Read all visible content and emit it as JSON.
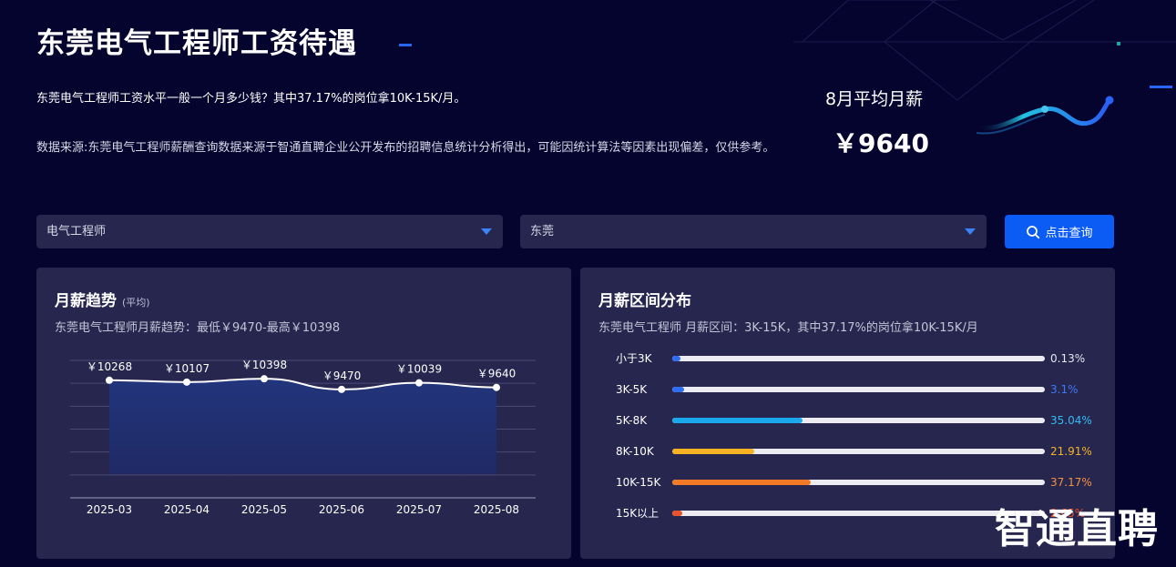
{
  "page": {
    "title": "东莞电气工程师工资待遇",
    "description": "东莞电气工程师工资水平一般一个月多少钱？其中37.17%的岗位拿10K-15K/月。",
    "source_note": "数据来源:东莞电气工程师薪酬查询数据来源于智通直聘企业公开发布的招聘信息统计分析得出，可能因统计算法等因素出现偏差，仅供参考。"
  },
  "summary": {
    "label": "8月平均月薪",
    "value": "￥9640"
  },
  "filters": {
    "job": "电气工程师",
    "city": "东莞",
    "query_label": "点击查询",
    "query_icon": "search-icon"
  },
  "trend_card": {
    "title": "月薪趋势",
    "title_note": "(平均)",
    "subtitle": "东莞电气工程师月薪趋势：最低￥9470-最高￥10398"
  },
  "dist_card": {
    "title": "月薪区间分布",
    "subtitle": "东莞电气工程师 月薪区间：3K-15K，其中37.17%的岗位拿10K-15K/月",
    "rows": [
      {
        "label": "小于3K",
        "percent": 0.13,
        "percent_label": "0.13%",
        "color": "#2f6df3",
        "text_color": "#e6e6ee"
      },
      {
        "label": "3K-5K",
        "percent": 3.1,
        "percent_label": "3.1%",
        "color": "#2f6df3",
        "text_color": "#3d7af5"
      },
      {
        "label": "5K-8K",
        "percent": 35.04,
        "percent_label": "35.04%",
        "color": "#19a9ec",
        "text_color": "#33bdf2"
      },
      {
        "label": "8K-10K",
        "percent": 21.91,
        "percent_label": "21.91%",
        "color": "#f5b324",
        "text_color": "#f5b324"
      },
      {
        "label": "10K-15K",
        "percent": 37.17,
        "percent_label": "37.17%",
        "color": "#f27a26",
        "text_color": "#f5923e"
      },
      {
        "label": "15K以上",
        "percent": 2.65,
        "percent_label": "2.65%",
        "color": "#e8532c",
        "text_color": "#e8532c"
      }
    ]
  },
  "chart_data": {
    "type": "area",
    "categories": [
      "2025-03",
      "2025-04",
      "2025-05",
      "2025-06",
      "2025-07",
      "2025-08"
    ],
    "values": [
      10268,
      10107,
      10398,
      9470,
      10039,
      9640
    ],
    "value_labels": [
      "￥10268",
      "￥10107",
      "￥10398",
      "￥9470",
      "￥10039",
      "￥9640"
    ],
    "ylim": [
      0,
      12000
    ],
    "grid": true,
    "colors": {
      "line": "#ffffff",
      "fill_top": "#22357e",
      "fill_bottom": "#1f2a66"
    }
  },
  "watermark": "智通直聘"
}
